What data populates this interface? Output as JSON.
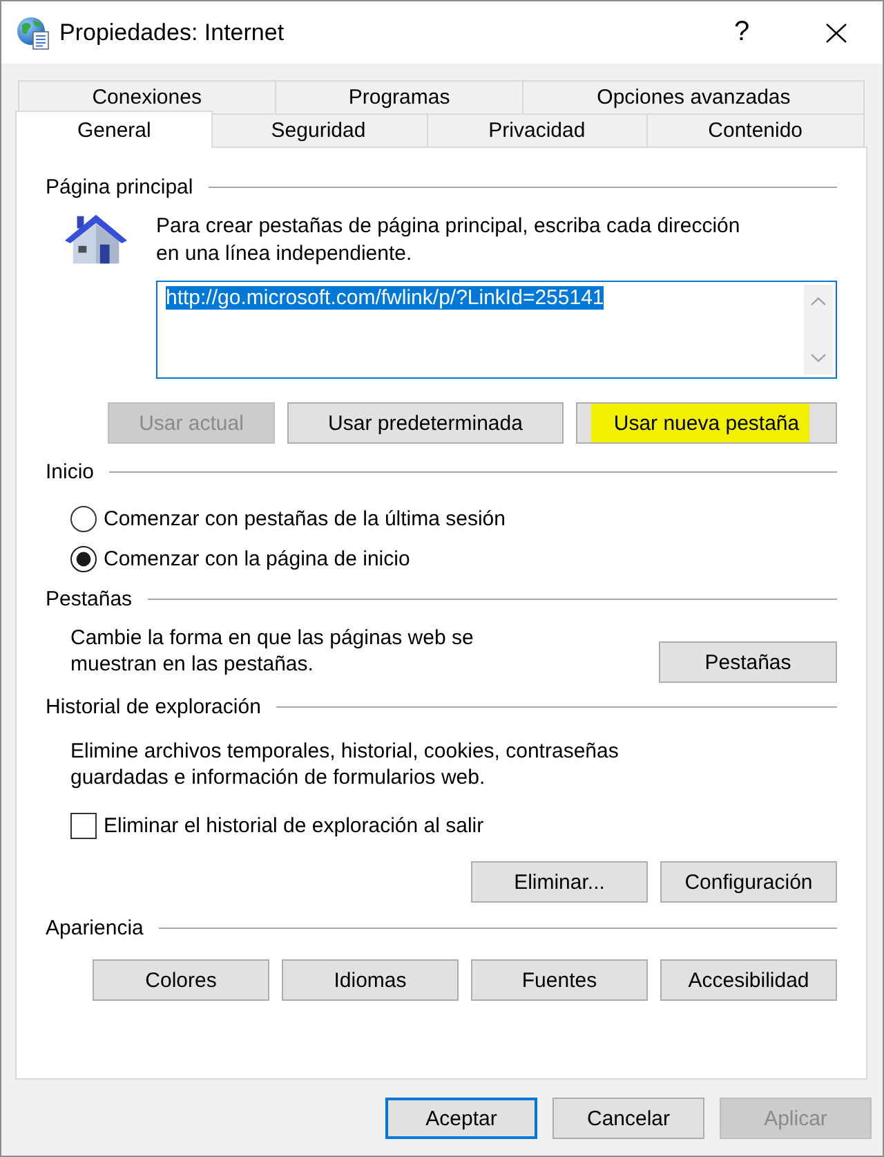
{
  "window": {
    "title": "Propiedades: Internet",
    "help": "?"
  },
  "tab_rows": [
    {
      "tabs": [
        {
          "label": "Conexiones",
          "selected": false
        },
        {
          "label": "Programas",
          "selected": false
        },
        {
          "label": "Opciones avanzadas",
          "selected": false
        }
      ]
    },
    {
      "tabs": [
        {
          "label": "General",
          "selected": true
        },
        {
          "label": "Seguridad",
          "selected": false
        },
        {
          "label": "Privacidad",
          "selected": false
        },
        {
          "label": "Contenido",
          "selected": false
        }
      ]
    }
  ],
  "home_page": {
    "title": "Página principal",
    "description": "Para crear pestañas de página principal, escriba cada dirección en una línea independiente.",
    "url_field": {
      "value": "http://go.microsoft.com/fwlink/p/?LinkId=255141",
      "text_selected": true
    },
    "buttons": [
      {
        "label": "Usar actual",
        "disabled": true,
        "highlighted": false
      },
      {
        "label": "Usar predeterminada",
        "disabled": false,
        "highlighted": false
      },
      {
        "label": "Usar nueva pestaña",
        "disabled": false,
        "highlighted": true
      }
    ]
  },
  "startup": {
    "title": "Inicio",
    "options": [
      {
        "label": "Comenzar con pestañas de la última sesión",
        "selected": false
      },
      {
        "label": "Comenzar con la página de inicio",
        "selected": true
      }
    ]
  },
  "tabs_section": {
    "title": "Pestañas",
    "description": "Cambie la forma en que las páginas web se muestran en las pestañas.",
    "button": {
      "label": "Pestañas"
    }
  },
  "browsing_history": {
    "title": "Historial de exploración",
    "description": "Elimine archivos temporales, historial, cookies, contraseñas guardadas e información de formularios web.",
    "delete_on_exit": {
      "label": "Eliminar el historial de exploración al salir",
      "checked": false
    },
    "buttons": [
      {
        "label": "Eliminar..."
      },
      {
        "label": "Configuración"
      }
    ]
  },
  "appearance": {
    "title": "Apariencia",
    "buttons": [
      {
        "label": "Colores"
      },
      {
        "label": "Idiomas"
      },
      {
        "label": "Fuentes"
      },
      {
        "label": "Accesibilidad"
      }
    ]
  },
  "footer_buttons": [
    {
      "label": "Aceptar",
      "default": true,
      "disabled": false
    },
    {
      "label": "Cancelar",
      "default": false,
      "disabled": false
    },
    {
      "label": "Aplicar",
      "default": false,
      "disabled": true
    }
  ]
}
